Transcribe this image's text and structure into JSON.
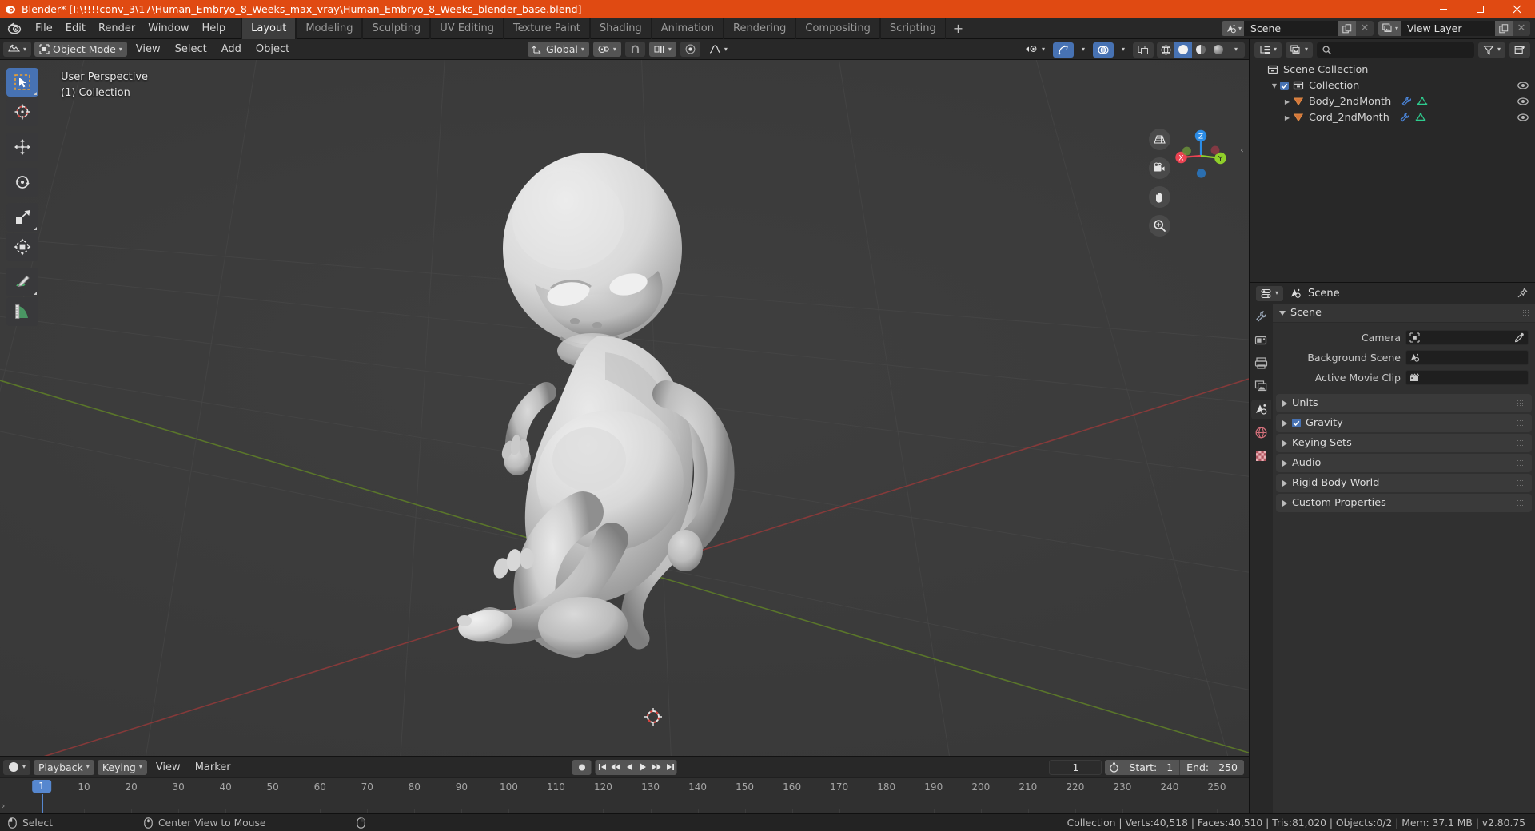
{
  "window": {
    "title": "Blender* [I:\\!!!!conv_3\\17\\Human_Embryo_8_Weeks_max_vray\\Human_Embryo_8_Weeks_blender_base.blend]",
    "app_icon": "blender-logo-icon",
    "minimize": "–",
    "maximize": "▢",
    "close": "✕",
    "accent_color": "#e04a12"
  },
  "topbar": {
    "menus": [
      "File",
      "Edit",
      "Render",
      "Window",
      "Help"
    ],
    "workspaces": [
      {
        "label": "Layout",
        "active": true
      },
      {
        "label": "Modeling",
        "active": false
      },
      {
        "label": "Sculpting",
        "active": false
      },
      {
        "label": "UV Editing",
        "active": false
      },
      {
        "label": "Texture Paint",
        "active": false
      },
      {
        "label": "Shading",
        "active": false
      },
      {
        "label": "Animation",
        "active": false
      },
      {
        "label": "Rendering",
        "active": false
      },
      {
        "label": "Compositing",
        "active": false
      },
      {
        "label": "Scripting",
        "active": false
      }
    ],
    "add_workspace": "+",
    "scene_selector": {
      "icon": "scene-icon",
      "value": "Scene",
      "copy": "copy-icon",
      "delete": "✕"
    },
    "viewlayer_selector": {
      "icon": "viewlayer-icon",
      "value": "View Layer",
      "copy": "copy-icon",
      "delete": "✕"
    }
  },
  "viewport_header": {
    "editor_type": "editor-type-3dview-icon",
    "mode": "Object Mode",
    "mode_icon": "object-mode-icon",
    "menus": [
      "View",
      "Select",
      "Add",
      "Object"
    ],
    "transform_orientation": "Global",
    "transform_orientation_icon": "orientation-icon",
    "pivot_icon": "pivot-point-icon",
    "snap_icon": "magnet-icon",
    "snap_target_icon": "snap-increment-icon",
    "proportional_icon": "proportional-edit-icon",
    "falloff_icon": "smooth-falloff-icon",
    "visibility_icon": "object-visibility-icon",
    "gizmo_icon": "gizmo-icon",
    "overlays_icon": "overlays-icon",
    "xray_icon": "xray-toggle-icon",
    "shading_modes": [
      "wireframe",
      "solid",
      "material-preview",
      "rendered"
    ],
    "shading_active": "solid"
  },
  "viewport": {
    "overlay_line1": "User Perspective",
    "overlay_line2": "(1) Collection",
    "toolbar": [
      {
        "name": "tweak-tool",
        "icon": "cursor-select-box-icon",
        "active": true,
        "has_submenu": true
      },
      {
        "name": "cursor-tool",
        "icon": "3d-cursor-icon",
        "active": false,
        "has_submenu": false
      },
      {
        "name": "move-tool",
        "icon": "move-arrows-icon",
        "active": false,
        "has_submenu": false
      },
      {
        "name": "rotate-tool",
        "icon": "rotate-icon",
        "active": false,
        "has_submenu": false
      },
      {
        "name": "scale-tool",
        "icon": "scale-icon",
        "active": false,
        "has_submenu": true
      },
      {
        "name": "transform-tool",
        "icon": "transform-icon",
        "active": false,
        "has_submenu": false
      },
      {
        "name": "annotate-tool",
        "icon": "annotate-pencil-icon",
        "active": false,
        "has_submenu": true
      },
      {
        "name": "measure-tool",
        "icon": "measure-ruler-icon",
        "active": false,
        "has_submenu": false
      }
    ],
    "nav_buttons": [
      {
        "name": "toggle-camera-perspective",
        "icon": "grid-perspective-icon"
      },
      {
        "name": "toggle-camera-view",
        "icon": "camera-icon"
      },
      {
        "name": "move-view",
        "icon": "hand-icon"
      },
      {
        "name": "zoom-view",
        "icon": "magnifier-plus-icon"
      }
    ],
    "gizmo": {
      "x": "X",
      "y": "Y",
      "z": "Z",
      "x_color": "#ec4352",
      "y_color": "#8fcf2a",
      "z_color": "#2b8ce6"
    },
    "sidebar_toggle": "‹",
    "model_name": "human-embryo-8-weeks-mesh"
  },
  "timeline": {
    "editor_icon": "timeline-editor-icon",
    "menus": [
      {
        "label": "Playback",
        "dropdown": true
      },
      {
        "label": "Keying",
        "dropdown": true
      },
      {
        "label": "View",
        "dropdown": false
      },
      {
        "label": "Marker",
        "dropdown": false
      }
    ],
    "transport": {
      "record": "record-keyframe-icon",
      "buttons": [
        "jump-start-icon",
        "prev-keyframe-icon",
        "play-reverse-icon",
        "play-icon",
        "next-keyframe-icon",
        "jump-end-icon"
      ]
    },
    "current_frame": "1",
    "use_preview_range_icon": "stopwatch-icon",
    "start_label": "Start:",
    "start_value": "1",
    "end_label": "End:",
    "end_value": "250",
    "ruler_ticks": [
      10,
      20,
      30,
      40,
      50,
      60,
      70,
      80,
      90,
      100,
      110,
      120,
      130,
      140,
      150,
      160,
      170,
      180,
      190,
      200,
      210,
      220,
      230,
      240,
      250
    ],
    "playhead_frame": "1",
    "playhead_color": "#5687cf"
  },
  "outliner": {
    "display_mode_icon": "outliner-display-mode-icon",
    "id_type_icon": "filter-id-type-icon",
    "search_placeholder": "",
    "search_value": "",
    "search_icon": "search-icon",
    "filter_icon": "filter-funnel-icon",
    "new_collection_icon": "new-collection-icon",
    "rows": [
      {
        "label": "Scene Collection",
        "level": 0,
        "icon": "collection-icon",
        "expandable": false,
        "checkbox": false,
        "eye": false,
        "modifier": false,
        "mesh": false
      },
      {
        "label": "Collection",
        "level": 1,
        "icon": "collection-icon",
        "expandable": true,
        "expanded": true,
        "checkbox": true,
        "checked": true,
        "eye": true,
        "modifier": false,
        "mesh": false
      },
      {
        "label": "Body_2ndMonth",
        "level": 2,
        "icon": "mesh-object-icon",
        "expandable": true,
        "expanded": false,
        "checkbox": false,
        "eye": true,
        "modifier": true,
        "mesh": true
      },
      {
        "label": "Cord_2ndMonth",
        "level": 2,
        "icon": "mesh-object-icon",
        "expandable": true,
        "expanded": false,
        "checkbox": false,
        "eye": true,
        "modifier": true,
        "mesh": true
      }
    ]
  },
  "properties": {
    "editor_icon": "properties-editor-icon",
    "breadcrumb_icon": "scene-icon",
    "breadcrumb": "Scene",
    "pin_icon": "pin-icon",
    "tabs": [
      {
        "name": "tool-tab",
        "icon": "wrench-screwdriver-icon",
        "active": false
      },
      {
        "name": "render-tab",
        "icon": "camera-back-icon",
        "active": false
      },
      {
        "name": "output-tab",
        "icon": "printer-icon",
        "active": false
      },
      {
        "name": "view-layer-tab",
        "icon": "images-icon",
        "active": false
      },
      {
        "name": "scene-tab",
        "icon": "scene-cone-icon",
        "active": true
      },
      {
        "name": "world-tab",
        "icon": "world-globe-icon",
        "active": false
      },
      {
        "name": "texture-tab",
        "icon": "checker-texture-icon",
        "active": false
      }
    ],
    "panels": [
      {
        "label": "Scene",
        "open": true,
        "fields": [
          {
            "label": "Camera",
            "icon": "camera-object-icon",
            "value": "",
            "eyedropper": true
          },
          {
            "label": "Background Scene",
            "icon": "scene-icon",
            "value": "",
            "eyedropper": false
          },
          {
            "label": "Active Movie Clip",
            "icon": "movie-clip-icon",
            "value": "",
            "eyedropper": false
          }
        ]
      },
      {
        "label": "Units",
        "open": false,
        "checkbox": false
      },
      {
        "label": "Gravity",
        "open": false,
        "checkbox": true,
        "checked": true
      },
      {
        "label": "Keying Sets",
        "open": false,
        "checkbox": false
      },
      {
        "label": "Audio",
        "open": false,
        "checkbox": false
      },
      {
        "label": "Rigid Body World",
        "open": false,
        "checkbox": false
      },
      {
        "label": "Custom Properties",
        "open": false,
        "checkbox": false
      }
    ]
  },
  "statusbar": {
    "keymap": [
      {
        "icon": "mouse-left-icon",
        "label": "Select"
      },
      {
        "icon": "mouse-middle-icon",
        "label": "Center View to Mouse"
      },
      {
        "icon": "mouse-right-icon",
        "label": ""
      }
    ],
    "stats": "Collection | Verts:40,518 | Faces:40,510 | Tris:81,020 | Objects:0/2 | Mem: 37.1 MB | v2.80.75"
  }
}
